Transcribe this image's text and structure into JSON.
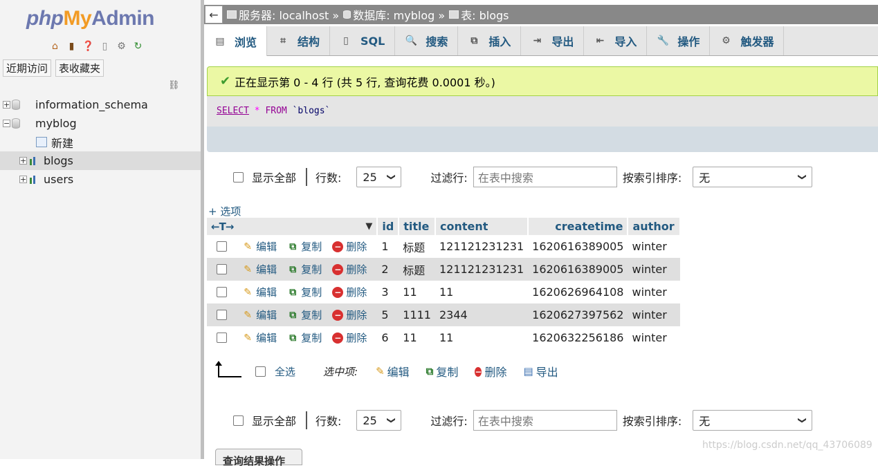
{
  "app": {
    "logo_php": "php",
    "logo_my": "My",
    "logo_admin": "Admin"
  },
  "nav": {
    "tabs": [
      "近期访问",
      "表收藏夹"
    ],
    "tree": [
      {
        "label": "information_schema",
        "type": "database",
        "toggle": "+"
      },
      {
        "label": "myblog",
        "type": "database",
        "toggle": "−"
      },
      {
        "label": "新建",
        "type": "new"
      },
      {
        "label": "blogs",
        "type": "table",
        "toggle": "+",
        "selected": true
      },
      {
        "label": "users",
        "type": "table",
        "toggle": "+"
      }
    ]
  },
  "breadcrumb": {
    "back": "←",
    "server": "服务器: localhost »",
    "database": "数据库: myblog »",
    "table": "表: blogs"
  },
  "tabs": [
    {
      "label": "浏览",
      "icon": "browse-icon",
      "glyph": "▤",
      "active": true
    },
    {
      "label": "结构",
      "icon": "structure-icon",
      "glyph": "⌗"
    },
    {
      "label": "SQL",
      "icon": "sql-icon",
      "glyph": "▯"
    },
    {
      "label": "搜索",
      "icon": "search-icon",
      "glyph": "🔍"
    },
    {
      "label": "插入",
      "icon": "insert-icon",
      "glyph": "⧉"
    },
    {
      "label": "导出",
      "icon": "export-icon",
      "glyph": "⇥"
    },
    {
      "label": "导入",
      "icon": "import-icon",
      "glyph": "⇤"
    },
    {
      "label": "操作",
      "icon": "wrench-icon",
      "glyph": "🔧"
    },
    {
      "label": "触发器",
      "icon": "trigger-icon",
      "glyph": "⚙"
    }
  ],
  "message": {
    "text": "正在显示第 0 - 4 行 (共 5 行, 查询花费 0.0001 秒。)"
  },
  "sql": {
    "select": "SELECT",
    "star": "*",
    "from": "FROM",
    "table": "`blogs`"
  },
  "filter": {
    "show_all": "显示全部",
    "rows_label": "行数:",
    "rows_value": "25",
    "filter_label": "过滤行:",
    "filter_placeholder": "在表中搜索",
    "sort_label": "按索引排序:",
    "sort_value": "无"
  },
  "table": {
    "options_link": "+ 选项",
    "arrows": "←T→",
    "columns": [
      "id",
      "title",
      "content",
      "createtime",
      "author"
    ],
    "actions": {
      "edit": "编辑",
      "copy": "复制",
      "delete": "删除"
    },
    "rows": [
      {
        "id": "1",
        "title": "标题",
        "content": "121121231231",
        "createtime": "1620616389005",
        "author": "winter"
      },
      {
        "id": "2",
        "title": "标题",
        "content": "121121231231",
        "createtime": "1620616389005",
        "author": "winter"
      },
      {
        "id": "3",
        "title": "11",
        "content": "11",
        "createtime": "1620626964108",
        "author": "winter"
      },
      {
        "id": "5",
        "title": "1111",
        "content": "2344",
        "createtime": "1620627397562",
        "author": "winter"
      },
      {
        "id": "6",
        "title": "11",
        "content": "11",
        "createtime": "1620632256186",
        "author": "winter"
      }
    ]
  },
  "with_selected": {
    "select_all": "全选",
    "label": "选中项:",
    "edit": "编辑",
    "copy": "复制",
    "delete": "删除",
    "export": "导出"
  },
  "bottom": {
    "query_ops": "查询结果操作",
    "watermark": "https://blog.csdn.net/qq_43706089"
  },
  "colors": {
    "link": "#235a81",
    "success_bg": "#ebf8a4",
    "row_alt": "#dfdfdf"
  }
}
